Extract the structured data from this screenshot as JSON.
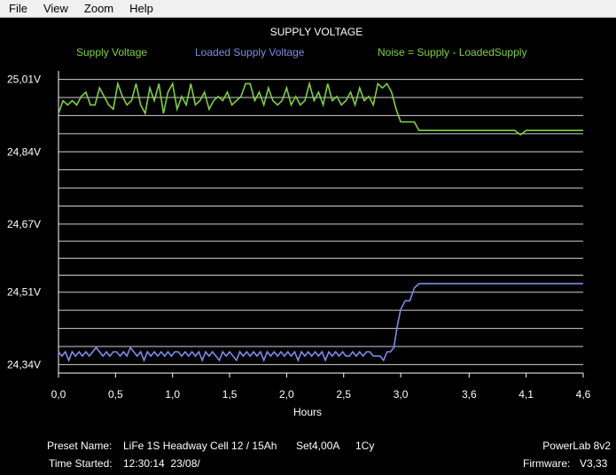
{
  "menu": [
    "File",
    "View",
    "Zoom",
    "Help"
  ],
  "chart_data": {
    "type": "line",
    "title": "SUPPLY VOLTAGE",
    "xlabel": "Hours",
    "ylabel": "",
    "x_ticks": [
      "0,0",
      "0,5",
      "1,0",
      "1,5",
      "2,0",
      "2,5",
      "3,0",
      "3,6",
      "4,1",
      "4,6"
    ],
    "x_tick_values": [
      0.0,
      0.5,
      1.0,
      1.5,
      2.0,
      2.5,
      3.0,
      3.6,
      4.1,
      4.6
    ],
    "xlim": [
      0,
      4.6
    ],
    "y_ticks": [
      "25,01V",
      "24,84V",
      "24,67V",
      "24,51V",
      "24,34V"
    ],
    "y_tick_values": [
      25.01,
      24.84,
      24.67,
      24.51,
      24.34
    ],
    "ylim": [
      24.32,
      25.03
    ],
    "grid": true,
    "legend": [
      {
        "name": "Supply Voltage",
        "color": "#7fd13b"
      },
      {
        "name": "Loaded Supply Voltage",
        "color": "#7b8ce8"
      },
      {
        "name": "Noise = Supply - LoadedSupply",
        "color": "#7fd13b"
      }
    ],
    "series": [
      {
        "name": "Supply Voltage",
        "color": "#7fd13b",
        "points": [
          [
            0.0,
            24.93
          ],
          [
            0.04,
            24.96
          ],
          [
            0.08,
            24.95
          ],
          [
            0.12,
            24.96
          ],
          [
            0.16,
            24.95
          ],
          [
            0.2,
            24.97
          ],
          [
            0.24,
            24.98
          ],
          [
            0.28,
            24.95
          ],
          [
            0.32,
            24.95
          ],
          [
            0.36,
            24.99
          ],
          [
            0.4,
            24.97
          ],
          [
            0.44,
            24.95
          ],
          [
            0.48,
            24.94
          ],
          [
            0.52,
            25.0
          ],
          [
            0.56,
            24.97
          ],
          [
            0.6,
            24.95
          ],
          [
            0.64,
            24.96
          ],
          [
            0.68,
            25.0
          ],
          [
            0.72,
            24.95
          ],
          [
            0.76,
            24.93
          ],
          [
            0.8,
            24.99
          ],
          [
            0.84,
            24.96
          ],
          [
            0.88,
            25.0
          ],
          [
            0.92,
            24.93
          ],
          [
            0.96,
            24.98
          ],
          [
            1.0,
            25.0
          ],
          [
            1.04,
            24.94
          ],
          [
            1.08,
            24.97
          ],
          [
            1.12,
            24.95
          ],
          [
            1.16,
            25.0
          ],
          [
            1.2,
            24.95
          ],
          [
            1.24,
            24.96
          ],
          [
            1.28,
            24.98
          ],
          [
            1.32,
            24.94
          ],
          [
            1.36,
            24.96
          ],
          [
            1.4,
            24.97
          ],
          [
            1.44,
            24.96
          ],
          [
            1.48,
            24.98
          ],
          [
            1.52,
            24.95
          ],
          [
            1.56,
            24.96
          ],
          [
            1.6,
            24.97
          ],
          [
            1.64,
            25.0
          ],
          [
            1.68,
            25.0
          ],
          [
            1.72,
            24.96
          ],
          [
            1.76,
            24.98
          ],
          [
            1.8,
            24.95
          ],
          [
            1.84,
            24.99
          ],
          [
            1.88,
            24.96
          ],
          [
            1.92,
            24.95
          ],
          [
            1.96,
            24.96
          ],
          [
            2.0,
            24.99
          ],
          [
            2.04,
            24.95
          ],
          [
            2.08,
            24.97
          ],
          [
            2.12,
            24.95
          ],
          [
            2.16,
            24.96
          ],
          [
            2.2,
            25.0
          ],
          [
            2.24,
            24.96
          ],
          [
            2.28,
            24.98
          ],
          [
            2.32,
            24.95
          ],
          [
            2.36,
            25.0
          ],
          [
            2.4,
            24.96
          ],
          [
            2.44,
            24.97
          ],
          [
            2.48,
            24.95
          ],
          [
            2.52,
            24.96
          ],
          [
            2.56,
            24.98
          ],
          [
            2.6,
            24.95
          ],
          [
            2.64,
            24.99
          ],
          [
            2.68,
            24.96
          ],
          [
            2.72,
            24.97
          ],
          [
            2.76,
            24.95
          ],
          [
            2.8,
            25.0
          ],
          [
            2.84,
            24.99
          ],
          [
            2.88,
            25.0
          ],
          [
            2.92,
            24.98
          ],
          [
            2.96,
            24.94
          ],
          [
            3.0,
            24.91
          ],
          [
            3.08,
            24.91
          ],
          [
            3.12,
            24.91
          ],
          [
            3.16,
            24.89
          ],
          [
            3.24,
            24.89
          ],
          [
            3.6,
            24.89
          ],
          [
            4.0,
            24.89
          ],
          [
            4.05,
            24.88
          ],
          [
            4.1,
            24.89
          ],
          [
            4.6,
            24.89
          ]
        ]
      },
      {
        "name": "Loaded Supply Voltage",
        "color": "#7b8ce8",
        "points": [
          [
            0.0,
            24.37
          ],
          [
            0.03,
            24.36
          ],
          [
            0.06,
            24.37
          ],
          [
            0.09,
            24.35
          ],
          [
            0.12,
            24.37
          ],
          [
            0.15,
            24.36
          ],
          [
            0.18,
            24.37
          ],
          [
            0.21,
            24.36
          ],
          [
            0.24,
            24.37
          ],
          [
            0.27,
            24.36
          ],
          [
            0.3,
            24.37
          ],
          [
            0.33,
            24.38
          ],
          [
            0.36,
            24.37
          ],
          [
            0.39,
            24.36
          ],
          [
            0.42,
            24.37
          ],
          [
            0.45,
            24.36
          ],
          [
            0.48,
            24.37
          ],
          [
            0.51,
            24.37
          ],
          [
            0.54,
            24.36
          ],
          [
            0.57,
            24.37
          ],
          [
            0.6,
            24.36
          ],
          [
            0.63,
            24.38
          ],
          [
            0.66,
            24.37
          ],
          [
            0.69,
            24.36
          ],
          [
            0.72,
            24.37
          ],
          [
            0.75,
            24.35
          ],
          [
            0.78,
            24.37
          ],
          [
            0.81,
            24.36
          ],
          [
            0.84,
            24.37
          ],
          [
            0.87,
            24.36
          ],
          [
            0.9,
            24.37
          ],
          [
            0.93,
            24.36
          ],
          [
            0.96,
            24.37
          ],
          [
            0.99,
            24.36
          ],
          [
            1.02,
            24.37
          ],
          [
            1.05,
            24.37
          ],
          [
            1.08,
            24.36
          ],
          [
            1.11,
            24.37
          ],
          [
            1.14,
            24.36
          ],
          [
            1.17,
            24.37
          ],
          [
            1.2,
            24.36
          ],
          [
            1.23,
            24.37
          ],
          [
            1.26,
            24.35
          ],
          [
            1.29,
            24.37
          ],
          [
            1.32,
            24.36
          ],
          [
            1.35,
            24.37
          ],
          [
            1.38,
            24.36
          ],
          [
            1.41,
            24.35
          ],
          [
            1.44,
            24.37
          ],
          [
            1.47,
            24.36
          ],
          [
            1.5,
            24.37
          ],
          [
            1.53,
            24.36
          ],
          [
            1.56,
            24.35
          ],
          [
            1.59,
            24.37
          ],
          [
            1.62,
            24.36
          ],
          [
            1.65,
            24.37
          ],
          [
            1.68,
            24.36
          ],
          [
            1.71,
            24.37
          ],
          [
            1.74,
            24.36
          ],
          [
            1.77,
            24.37
          ],
          [
            1.8,
            24.35
          ],
          [
            1.83,
            24.37
          ],
          [
            1.86,
            24.36
          ],
          [
            1.89,
            24.37
          ],
          [
            1.92,
            24.36
          ],
          [
            1.95,
            24.37
          ],
          [
            1.98,
            24.36
          ],
          [
            2.01,
            24.37
          ],
          [
            2.04,
            24.36
          ],
          [
            2.07,
            24.37
          ],
          [
            2.1,
            24.35
          ],
          [
            2.13,
            24.37
          ],
          [
            2.16,
            24.36
          ],
          [
            2.19,
            24.37
          ],
          [
            2.22,
            24.36
          ],
          [
            2.25,
            24.37
          ],
          [
            2.28,
            24.36
          ],
          [
            2.31,
            24.37
          ],
          [
            2.34,
            24.35
          ],
          [
            2.37,
            24.37
          ],
          [
            2.4,
            24.36
          ],
          [
            2.43,
            24.37
          ],
          [
            2.46,
            24.36
          ],
          [
            2.49,
            24.37
          ],
          [
            2.52,
            24.36
          ],
          [
            2.55,
            24.36
          ],
          [
            2.58,
            24.37
          ],
          [
            2.61,
            24.36
          ],
          [
            2.64,
            24.37
          ],
          [
            2.67,
            24.36
          ],
          [
            2.7,
            24.37
          ],
          [
            2.73,
            24.37
          ],
          [
            2.76,
            24.36
          ],
          [
            2.79,
            24.36
          ],
          [
            2.82,
            24.36
          ],
          [
            2.85,
            24.35
          ],
          [
            2.88,
            24.37
          ],
          [
            2.91,
            24.37
          ],
          [
            2.94,
            24.38
          ],
          [
            2.97,
            24.43
          ],
          [
            3.0,
            24.47
          ],
          [
            3.04,
            24.49
          ],
          [
            3.08,
            24.49
          ],
          [
            3.12,
            24.52
          ],
          [
            3.16,
            24.53
          ],
          [
            3.2,
            24.53
          ],
          [
            4.6,
            24.53
          ]
        ]
      }
    ]
  },
  "footer": {
    "preset_label": "Preset Name:",
    "preset_value": "LiFe 1S Headway Cell 12 / 15Ah",
    "set_current": "Set4,00A",
    "cycles": "1Cy",
    "device": "PowerLab 8v2",
    "time_label": "Time Started:",
    "time_value": "12:30:14  23/08/",
    "firmware_label": "Firmware:",
    "firmware_value": "V3,33"
  },
  "colors": {
    "background": "#000000",
    "grid": "#d0d0d0",
    "axis": "#ffffff",
    "text": "#ffffff",
    "supply": "#7fd13b",
    "loaded": "#7b8ce8"
  }
}
